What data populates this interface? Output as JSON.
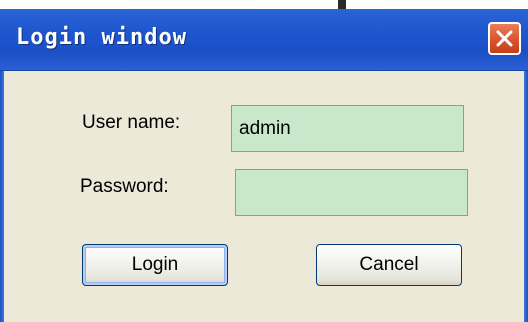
{
  "window": {
    "title": "Login window",
    "close_icon": "close-icon"
  },
  "form": {
    "username_label": "User name:",
    "username_value": "admin",
    "password_label": "Password:",
    "password_value": ""
  },
  "buttons": {
    "login_label": "Login",
    "cancel_label": "Cancel"
  },
  "colors": {
    "titlebar": "#1f57d0",
    "client_bg": "#ece9d8",
    "field_bg": "#c9e8cb",
    "close_button": "#d8542d"
  }
}
